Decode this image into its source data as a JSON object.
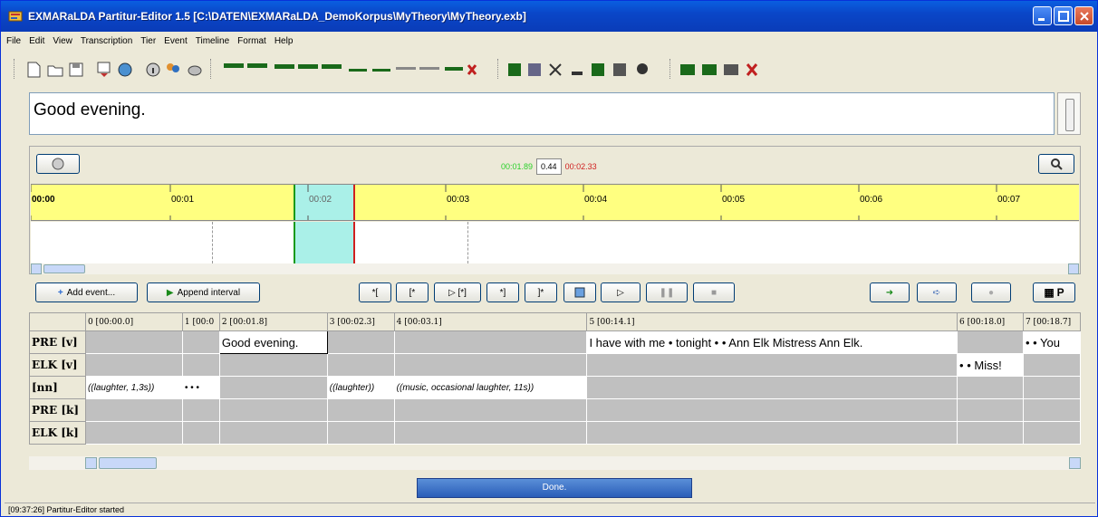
{
  "window": {
    "title": "EXMARaLDA Partitur-Editor 1.5 [C:\\DATEN\\EXMARaLDA_DemoKorpus\\MyTheory\\MyTheory.exb]"
  },
  "menu": [
    "File",
    "Edit",
    "View",
    "Transcription",
    "Tier",
    "Event",
    "Timeline",
    "Format",
    "Help"
  ],
  "editor": {
    "text": "Good evening."
  },
  "timeline": {
    "start": "00:01.89",
    "length": "0.44",
    "end": "00:02.33",
    "ticks": [
      "00:00",
      "00:01",
      "00:02",
      "00:03",
      "00:04",
      "00:05",
      "00:06",
      "00:07"
    ]
  },
  "actions": {
    "add_event": "Add event...",
    "append_interval": "Append interval",
    "mark_buttons": [
      "*[",
      "[*",
      "▷ [*]",
      "*]",
      "]*"
    ],
    "p_label": "P"
  },
  "grid": {
    "headers": [
      "0 [00:00.0]",
      "1 [00:0",
      "2 [00:01.8]",
      "3 [00:02.3]",
      "4 [00:03.1]",
      "5 [00:14.1]",
      "6 [00:18.0]",
      "7 [00:18.7]"
    ],
    "tiers": [
      "PRE [v]",
      "ELK [v]",
      "[nn]",
      "PRE [k]",
      "ELK [k]"
    ],
    "pre_v_1": "Good evening.",
    "pre_v_2": "I have with me • tonight • • Ann Elk Mistress Ann Elk.",
    "pre_v_3": "• • You",
    "elk_v_1": "• • Miss!",
    "nn_1": "((laughter, 1,3s))",
    "nn_2": "• • •",
    "nn_3": "((laughter))",
    "nn_4": "((music, occasional laughter, 11s))"
  },
  "progress": {
    "label": "Done."
  },
  "status": {
    "text": "[09:37:26] Partitur-Editor started"
  }
}
